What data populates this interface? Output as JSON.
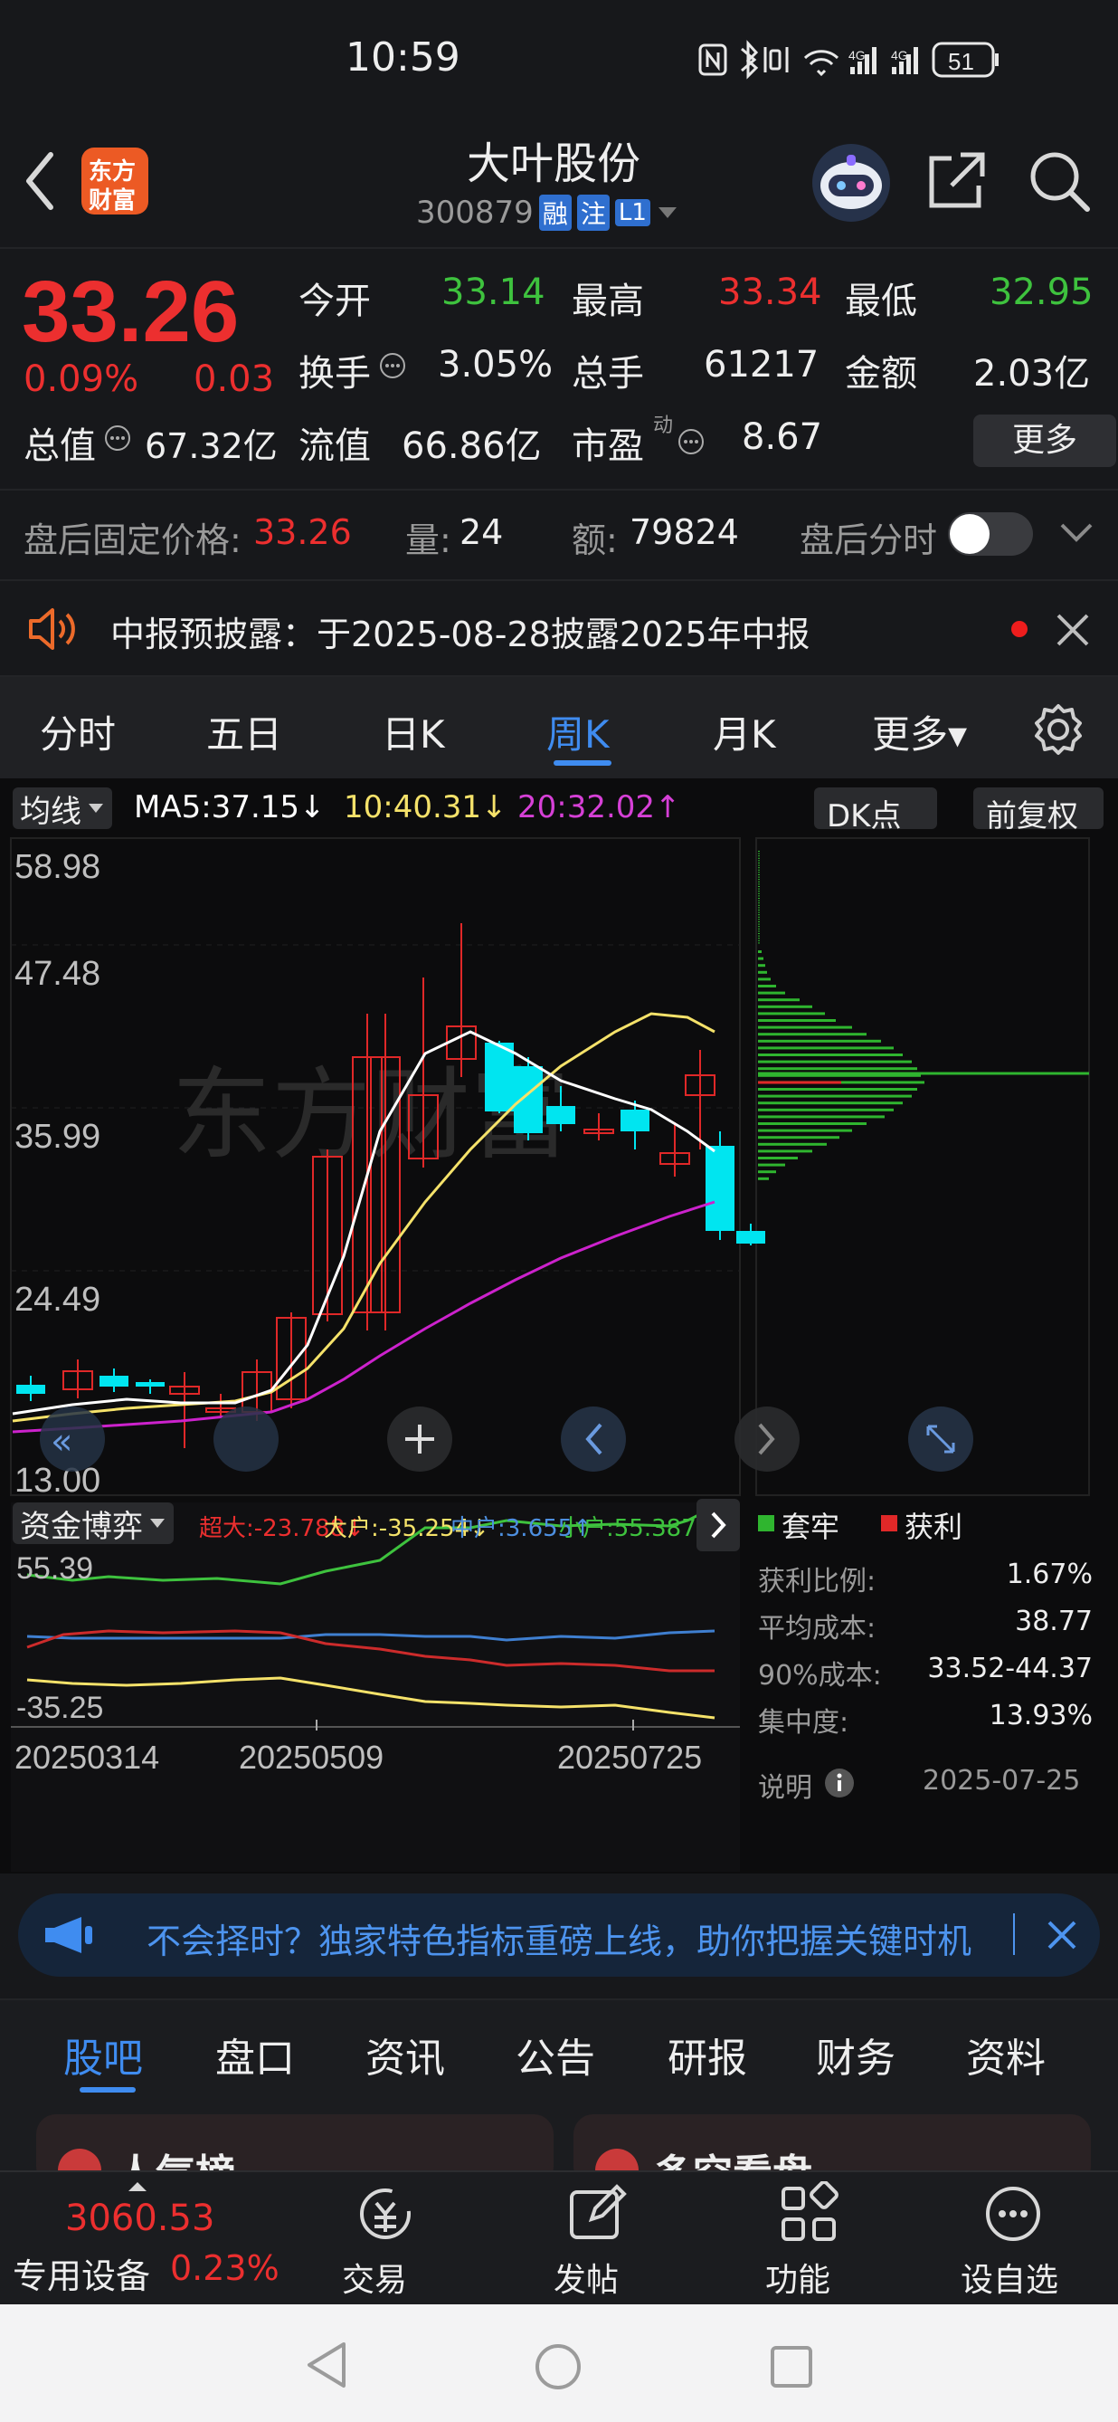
{
  "status": {
    "time": "10:59",
    "net1": "4G",
    "net2": "4G",
    "battery": "51"
  },
  "header": {
    "logo_line1": "东方",
    "logo_line2": "财富",
    "title": "大叶股份",
    "code": "300879",
    "tag1": "融",
    "tag2": "注",
    "tag3": "L1"
  },
  "quote": {
    "price": "33.26",
    "pct": "0.09%",
    "chg": "0.03",
    "open_label": "今开",
    "open": "33.14",
    "high_label": "最高",
    "high": "33.34",
    "low_label": "最低",
    "low": "32.95",
    "turnover_label": "换手",
    "turnover": "3.05%",
    "volume_label": "总手",
    "volume": "61217",
    "amount_label": "金额",
    "amount": "2.03亿",
    "mktcap_label": "总值",
    "mktcap": "67.32亿",
    "float_label": "流值",
    "float": "66.86亿",
    "pe_label": "市盈",
    "pe_sup": "动",
    "pe": "8.67",
    "more": "更多"
  },
  "after_hours": {
    "price_label": "盘后固定价格:",
    "price": "33.26",
    "vol_label": "量:",
    "vol": "24",
    "amt_label": "额:",
    "amt": "79824",
    "switch_label": "盘后分时"
  },
  "notice": {
    "text": "中报预披露：于2025-08-28披露2025年中报"
  },
  "period_tabs": [
    "分时",
    "五日",
    "日K",
    "周K",
    "月K",
    "更多▾"
  ],
  "kline": {
    "ma_selector": "均线",
    "ma5": "MA5:37.15↓",
    "ma10": "10:40.31↓",
    "ma20": "20:32.02↑",
    "dk": "DK点",
    "fq": "前复权",
    "watermark": "东方财富",
    "axis": [
      "58.98",
      "47.48",
      "35.99",
      "24.49",
      "13.00"
    ],
    "colors": {
      "up": "#e02828",
      "down": "#00e5f0",
      "ma5": "#ffffff",
      "ma10": "#f5e26a",
      "ma20": "#cc22cc"
    }
  },
  "chips": {
    "legend_trapped": "套牢",
    "legend_profit": "获利",
    "rows": [
      {
        "k": "获利比例:",
        "v": "1.67%"
      },
      {
        "k": "平均成本:",
        "v": "38.77"
      },
      {
        "k": "90%成本:",
        "v": "33.52-44.37"
      },
      {
        "k": "集中度:",
        "v": "13.93%"
      }
    ],
    "explain": "说明",
    "date": "2025-07-25"
  },
  "funds": {
    "selector": "资金博弈",
    "super": "超大:-23.788↓",
    "big": "大户:-35.254↓",
    "mid": "中户:3.655↑",
    "small": "小户:55.387↑",
    "max": "55.39",
    "min": "-35.25",
    "dates": [
      "20250314",
      "20250509",
      "20250725"
    ]
  },
  "promo": {
    "text": "不会择时？独家特色指标重磅上线，助你把握关键时机"
  },
  "bottom_tabs": [
    "股吧",
    "盘口",
    "资讯",
    "公告",
    "研报",
    "财务",
    "资料"
  ],
  "cards": {
    "c1": "人气榜",
    "c2": "多空看盘"
  },
  "bottombar": {
    "index_value": "3060.53",
    "index_name": "专用设备",
    "index_pct": "0.23%",
    "trade": "交易",
    "post": "发帖",
    "func": "功能",
    "watch": "设自选"
  }
}
